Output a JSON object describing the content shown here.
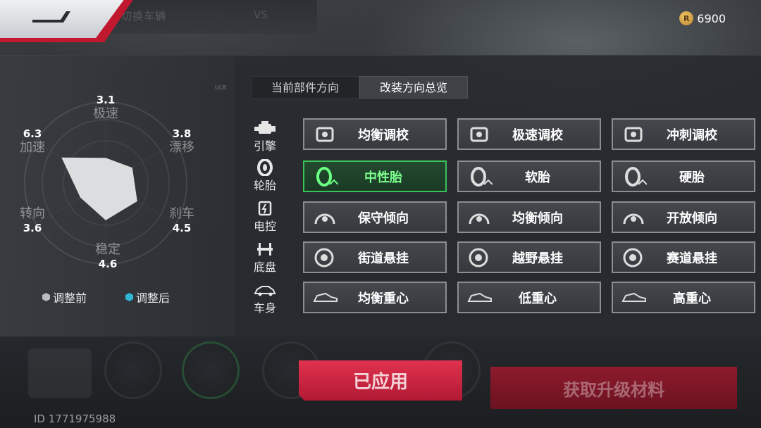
{
  "header": {
    "back_label": "",
    "currency_value": "6900",
    "bg_text_left": "切换车辆",
    "bg_text_right": "VS"
  },
  "radar": {
    "stats": [
      {
        "name": "极速",
        "value": "3.1"
      },
      {
        "name": "漂移",
        "value": "3.8"
      },
      {
        "name": "刹车",
        "value": "4.5"
      },
      {
        "name": "稳定",
        "value": "4.6"
      },
      {
        "name": "转向",
        "value": "3.6"
      },
      {
        "name": "加速",
        "value": "6.3"
      }
    ],
    "legend_before": "调整前",
    "legend_after": "调整后",
    "colors": {
      "before": "#b9bcc1",
      "after": "#2fb7d6"
    },
    "tag": "ULB"
  },
  "tabs": [
    {
      "label": "当前部件方向",
      "active": false
    },
    {
      "label": "改装方向总览",
      "active": true
    }
  ],
  "categories": [
    {
      "label": "引擎",
      "icon": "engine-icon"
    },
    {
      "label": "轮胎",
      "icon": "tire-icon"
    },
    {
      "label": "电控",
      "icon": "chip-icon"
    },
    {
      "label": "底盘",
      "icon": "chassis-icon"
    },
    {
      "label": "车身",
      "icon": "car-body-icon"
    }
  ],
  "options": [
    [
      {
        "label": "均衡调校"
      },
      {
        "label": "极速调校"
      },
      {
        "label": "冲刺调校"
      }
    ],
    [
      {
        "label": "中性胎",
        "selected": true
      },
      {
        "label": "软胎"
      },
      {
        "label": "硬胎"
      }
    ],
    [
      {
        "label": "保守倾向"
      },
      {
        "label": "均衡倾向"
      },
      {
        "label": "开放倾向"
      }
    ],
    [
      {
        "label": "街道悬挂"
      },
      {
        "label": "越野悬挂"
      },
      {
        "label": "赛道悬挂"
      }
    ],
    [
      {
        "label": "均衡重心"
      },
      {
        "label": "低重心"
      },
      {
        "label": "高重心"
      }
    ]
  ],
  "bottom": {
    "applied_label": "已应用",
    "material_label": "获取升级材料",
    "id_text": "ID 1771975988"
  }
}
